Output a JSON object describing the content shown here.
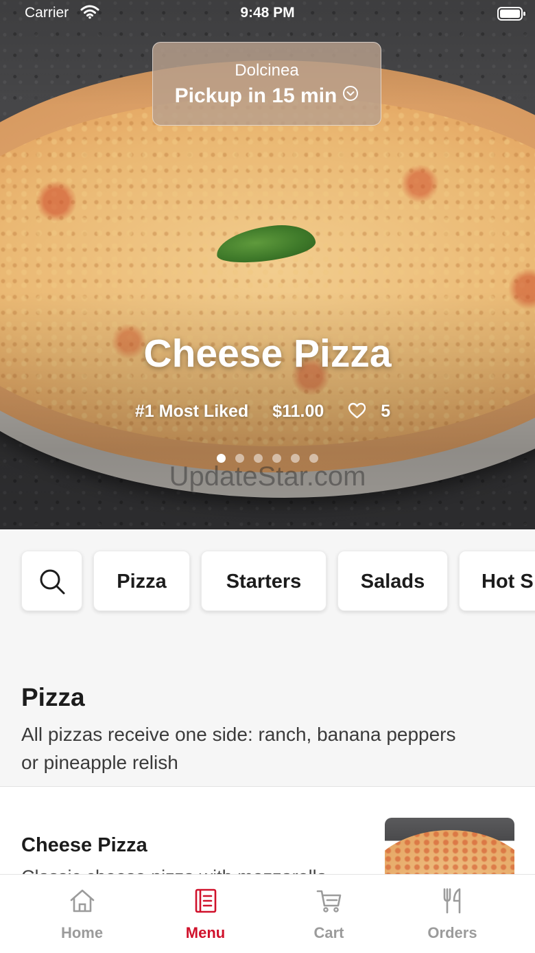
{
  "status_bar": {
    "carrier": "Carrier",
    "time": "9:48 PM"
  },
  "pickup": {
    "store_name": "Dolcinea",
    "pickup_time": "Pickup in 15 min"
  },
  "hero": {
    "title": "Cheese Pizza",
    "rank": "#1 Most Liked",
    "price": "$11.00",
    "likes": "5",
    "carousel_pages": 6,
    "carousel_active": 1,
    "watermark": "UpdateStar.com"
  },
  "categories": {
    "search_icon": "search-icon",
    "items": [
      "Pizza",
      "Starters",
      "Salads",
      "Hot S"
    ]
  },
  "section": {
    "title": "Pizza",
    "description": "All pizzas receive one side: ranch, banana peppers or pineapple relish"
  },
  "menu_item": {
    "name": "Cheese Pizza",
    "description": "Classic cheese pizza with mozzarella"
  },
  "tabbar": {
    "accent_color": "#d0112b",
    "inactive_color": "#9b9b9b",
    "items": [
      {
        "label": "Home",
        "icon": "home-icon"
      },
      {
        "label": "Menu",
        "icon": "menu-icon"
      },
      {
        "label": "Cart",
        "icon": "cart-icon"
      },
      {
        "label": "Orders",
        "icon": "utensils-icon"
      }
    ]
  }
}
